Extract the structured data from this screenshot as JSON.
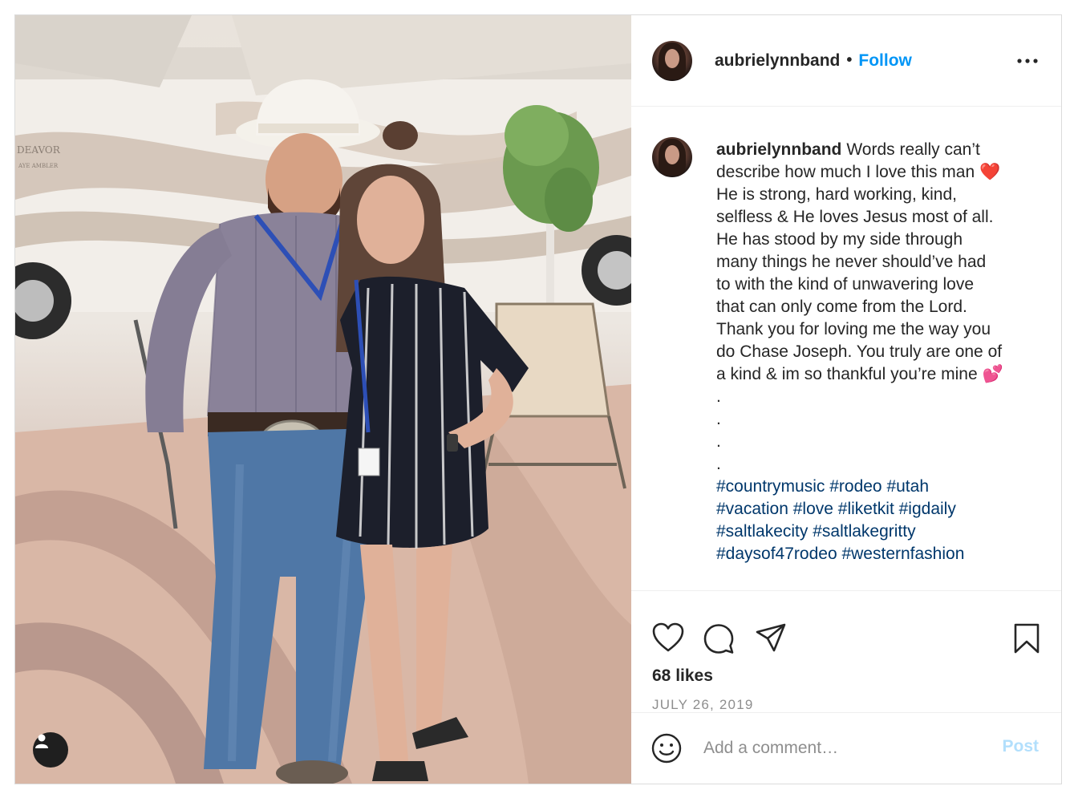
{
  "colors": {
    "follow": "#0095f6",
    "hashtag": "#00376b",
    "muted": "#8e8e8e",
    "post_disabled": "#b2dffc",
    "heart": "#e0245e",
    "pink_hearts": "#ff4fa3"
  },
  "photo": {
    "rv_text_1": "DEAVOR",
    "rv_text_2": "AYE AMBLER",
    "user_tag_icon": "user-icon"
  },
  "header": {
    "username": "aubrielynnband",
    "separator": "•",
    "follow_label": "Follow",
    "more_icon": "more-horizontal-icon"
  },
  "caption": {
    "username": "aubrielynnband",
    "lines": [
      "Words really can’t",
      "describe how much I love this man",
      "He is strong, hard working, kind,",
      "selfless & He loves Jesus most of all.",
      "He has stood by my side through",
      "many things he never should’ve had",
      "to with the kind of unwavering love",
      "that can only come from the Lord.",
      "Thank you for loving me the way you",
      "do Chase Joseph. You truly are one of",
      "a kind & im so thankful you’re mine"
    ],
    "emoji_1": "❤️",
    "emoji_2": "💕",
    "dots": [
      ".",
      ".",
      ".",
      "."
    ],
    "hashtag_lines": [
      "#countrymusic #rodeo #utah",
      "#vacation #love #liketkit #igdaily",
      "#saltlakecity #saltlakegritty",
      "#daysof47rodeo #westernfashion"
    ]
  },
  "actions": {
    "like_icon": "heart-icon",
    "comment_icon": "comment-icon",
    "share_icon": "paper-plane-icon",
    "save_icon": "bookmark-icon",
    "likes": "68 likes",
    "date": "JULY 26, 2019"
  },
  "comment": {
    "emoji_icon": "smiley-icon",
    "placeholder": "Add a comment…",
    "post_label": "Post"
  }
}
